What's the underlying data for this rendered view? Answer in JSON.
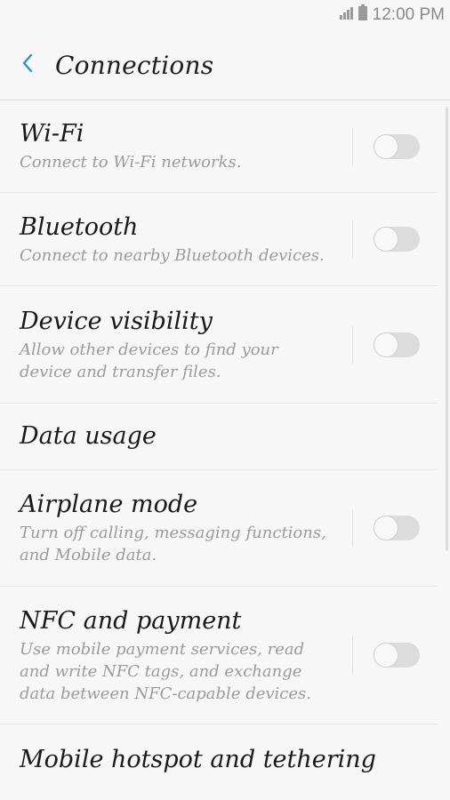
{
  "status_bar": {
    "time": "12:00 PM"
  },
  "app_bar": {
    "title": "Connections"
  },
  "items": [
    {
      "title": "Wi-Fi",
      "subtitle": "Connect to Wi-Fi networks.",
      "toggle": false
    },
    {
      "title": "Bluetooth",
      "subtitle": "Connect to nearby Bluetooth devices.",
      "toggle": false
    },
    {
      "title": "Device visibility",
      "subtitle": "Allow other devices to find your device and transfer files.",
      "toggle": false
    },
    {
      "title": "Data usage"
    },
    {
      "title": "Airplane mode",
      "subtitle": "Turn off calling, messaging functions, and Mobile data.",
      "toggle": false
    },
    {
      "title": "NFC and payment",
      "subtitle": "Use mobile payment services, read and write NFC tags, and exchange data between NFC-capable devices.",
      "toggle": false
    },
    {
      "title": "Mobile hotspot and tethering"
    }
  ],
  "colors": {
    "accent": "#2a95c4",
    "toggle_off_track": "#dcdcdc"
  }
}
